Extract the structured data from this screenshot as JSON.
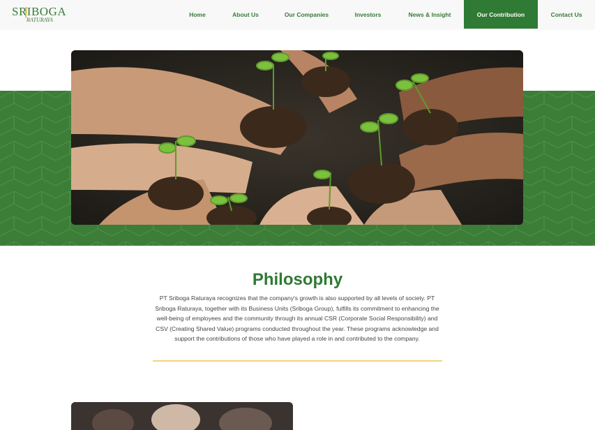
{
  "brand": {
    "name": "SRIBOGA",
    "sub": "RATURAYA"
  },
  "nav": {
    "items": [
      {
        "label": "Home"
      },
      {
        "label": "About Us"
      },
      {
        "label": "Our Companies"
      },
      {
        "label": "Investors"
      },
      {
        "label": "News & Insight"
      },
      {
        "label": "Our Contribution"
      },
      {
        "label": "Contact Us"
      }
    ],
    "active": "Our Contribution"
  },
  "colors": {
    "brand_green": "#2f7a34",
    "band_green": "#3c7d37",
    "divider_gold": "#f2d57a"
  },
  "hero": {
    "image": "hands-holding-seedlings-photo"
  },
  "philosophy": {
    "title": "Philosophy",
    "body": "PT Sriboga Raturaya recognizes that the company's growth is also supported by all levels of society. PT Sriboga Raturaya, together with its Business Units (Sriboga Group), fulfills its commitment to enhancing the well-being of employees and the community through its annual CSR (Corporate Social Responsibility) and CSV (Creating Shared Value) programs conducted throughout the year. These programs acknowledge and support the contributions of those who have played a role in and contributed to the company."
  }
}
